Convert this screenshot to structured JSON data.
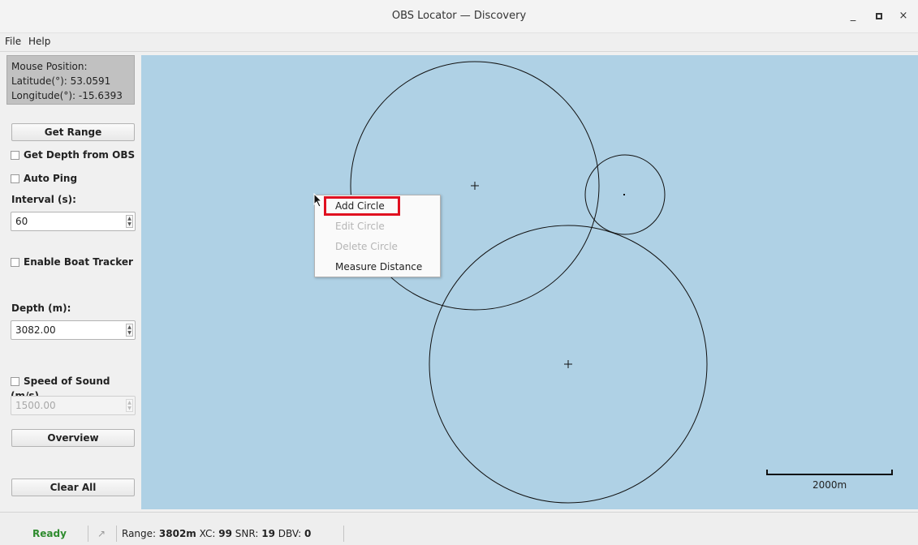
{
  "window": {
    "title": "OBS Locator — Discovery",
    "minimize": "_",
    "maximize": "▫",
    "close": "×"
  },
  "menubar": {
    "file": "File",
    "help": "Help"
  },
  "mouse_position": {
    "header": "Mouse Position:",
    "latitude": "Latitude(°): 53.0591",
    "longitude": "Longitude(°): -15.6393"
  },
  "sidebar": {
    "get_range": "Get Range",
    "get_depth": {
      "label": "Get Depth from OBS",
      "checked": false
    },
    "auto_ping": {
      "label": "Auto Ping",
      "checked": false
    },
    "interval_label": "Interval (s):",
    "interval_value": "60",
    "boat_tracker": {
      "label": "Enable Boat Tracker",
      "checked": false
    },
    "depth_label": "Depth (m):",
    "depth_value": "3082.00",
    "speed_of_sound": {
      "label": "Speed of Sound (m/s)",
      "checked": false
    },
    "speed_value": "1500.00",
    "overview": "Overview",
    "clear_all": "Clear All"
  },
  "map": {
    "background": "#afd1e5",
    "scale_label": "2000m"
  },
  "context_menu": {
    "items": [
      {
        "label": "Add Circle",
        "enabled": true,
        "highlighted": true
      },
      {
        "label": "Edit Circle",
        "enabled": false
      },
      {
        "label": "Delete Circle",
        "enabled": false
      },
      {
        "label": "Measure Distance",
        "enabled": true
      }
    ]
  },
  "status": {
    "state": "Ready",
    "state_color": "#2e8b2e",
    "range_label": "Range:",
    "range_value": "3802m",
    "xc_label": "XC:",
    "xc_value": "99",
    "snr_label": "SNR:",
    "snr_value": "19",
    "dbv_label": "DBV:",
    "dbv_value": "0"
  }
}
